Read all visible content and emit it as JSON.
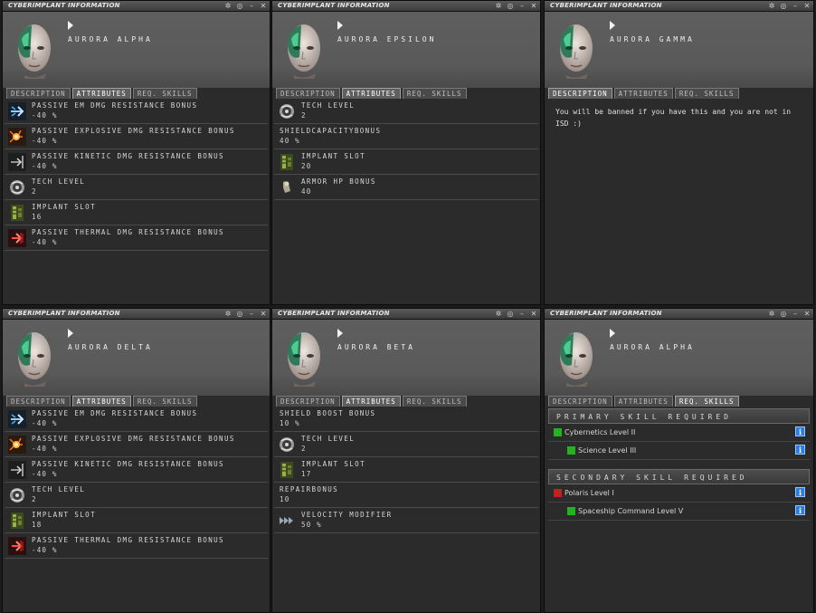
{
  "window_title": "CYBERIMPLANT INFORMATION",
  "tabs": [
    "DESCRIPTION",
    "ATTRIBUTES",
    "REQ. SKILLS"
  ],
  "colors": {
    "skill_trained": "#22b322",
    "skill_missing": "#c42020"
  },
  "windows": [
    {
      "name": "AURORA ALPHA",
      "active_tab": "ATTRIBUTES",
      "attributes": [
        {
          "icon": "em-resistance-icon",
          "label": "PASSIVE EM DMG RESISTANCE BONUS",
          "value": "-40 %"
        },
        {
          "icon": "explosive-resistance-icon",
          "label": "PASSIVE EXPLOSIVE DMG RESISTANCE BONUS",
          "value": "-40 %"
        },
        {
          "icon": "kinetic-resistance-icon",
          "label": "PASSIVE KINETIC DMG RESISTANCE BONUS",
          "value": "-40 %"
        },
        {
          "icon": "tech-level-icon",
          "label": "TECH LEVEL",
          "value": "2"
        },
        {
          "icon": "implant-slot-icon",
          "label": "IMPLANT SLOT",
          "value": "16"
        },
        {
          "icon": "thermal-resistance-icon",
          "label": "PASSIVE THERMAL DMG RESISTANCE BONUS",
          "value": "-40 %"
        }
      ]
    },
    {
      "name": "AURORA EPSILON",
      "active_tab": "ATTRIBUTES",
      "attributes": [
        {
          "icon": "tech-level-icon",
          "label": "TECH LEVEL",
          "value": "2"
        },
        {
          "icon": "",
          "label": "SHIELDCAPACITYBONUS",
          "value": "40 %"
        },
        {
          "icon": "implant-slot-icon",
          "label": "IMPLANT SLOT",
          "value": "20"
        },
        {
          "icon": "armor-hp-icon",
          "label": "ARMOR HP BONUS",
          "value": "40"
        }
      ]
    },
    {
      "name": "AURORA GAMMA",
      "active_tab": "DESCRIPTION",
      "description": "You will be banned if you have this and you are not in ISD :)"
    },
    {
      "name": "AURORA DELTA",
      "active_tab": "ATTRIBUTES",
      "attributes": [
        {
          "icon": "em-resistance-icon",
          "label": "PASSIVE EM DMG RESISTANCE BONUS",
          "value": "-40 %"
        },
        {
          "icon": "explosive-resistance-icon",
          "label": "PASSIVE EXPLOSIVE DMG RESISTANCE BONUS",
          "value": "-40 %"
        },
        {
          "icon": "kinetic-resistance-icon",
          "label": "PASSIVE KINETIC DMG RESISTANCE BONUS",
          "value": "-40 %"
        },
        {
          "icon": "tech-level-icon",
          "label": "TECH LEVEL",
          "value": "2"
        },
        {
          "icon": "implant-slot-icon",
          "label": "IMPLANT SLOT",
          "value": "18"
        },
        {
          "icon": "thermal-resistance-icon",
          "label": "PASSIVE THERMAL DMG RESISTANCE BONUS",
          "value": "-40 %"
        }
      ]
    },
    {
      "name": "AURORA BETA",
      "active_tab": "ATTRIBUTES",
      "attributes": [
        {
          "icon": "",
          "label": "SHIELD BOOST BONUS",
          "value": "10 %"
        },
        {
          "icon": "tech-level-icon",
          "label": "TECH LEVEL",
          "value": "2"
        },
        {
          "icon": "implant-slot-icon",
          "label": "IMPLANT SLOT",
          "value": "17"
        },
        {
          "icon": "",
          "label": "REPAIRBONUS",
          "value": "10"
        },
        {
          "icon": "velocity-icon",
          "label": "VELOCITY MODIFIER",
          "value": "50 %"
        }
      ]
    },
    {
      "name": "AURORA ALPHA",
      "active_tab": "REQ. SKILLS",
      "skills": {
        "primary_header": "PRIMARY SKILL REQUIRED",
        "primary": [
          {
            "name": "Cybernetics Level II",
            "indent": 0,
            "status": "trained"
          },
          {
            "name": "Science Level III",
            "indent": 1,
            "status": "trained"
          }
        ],
        "secondary_header": "SECONDARY SKILL REQUIRED",
        "secondary": [
          {
            "name": "Polaris Level I",
            "indent": 0,
            "status": "missing"
          },
          {
            "name": "Spaceship Command Level V",
            "indent": 1,
            "status": "trained"
          }
        ]
      }
    }
  ]
}
